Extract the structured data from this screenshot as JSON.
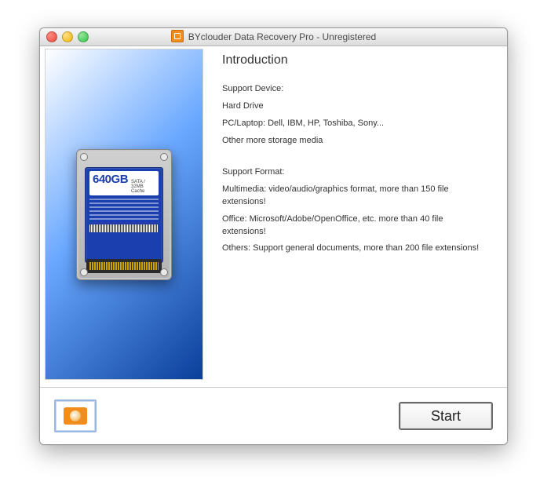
{
  "window": {
    "title": "BYclouder Data Recovery Pro - Unregistered"
  },
  "hdd": {
    "capacity": "640GB",
    "subtext": "SATA / 32MB Cache"
  },
  "intro": {
    "heading": "Introduction",
    "device_label": "Support Device:",
    "device_lines": {
      "l1": "Hard Drive",
      "l2": "PC/Laptop: Dell, IBM, HP, Toshiba, Sony...",
      "l3": "Other more storage media"
    },
    "format_label": "Support Format:",
    "format_lines": {
      "l1": "Multimedia: video/audio/graphics format, more than 150 file extensions!",
      "l2": "Office: Microsoft/Adobe/OpenOffice, etc. more than 40 file extensions!",
      "l3": "Others: Support general documents, more than 200 file extensions!"
    }
  },
  "actions": {
    "start_label": "Start"
  }
}
